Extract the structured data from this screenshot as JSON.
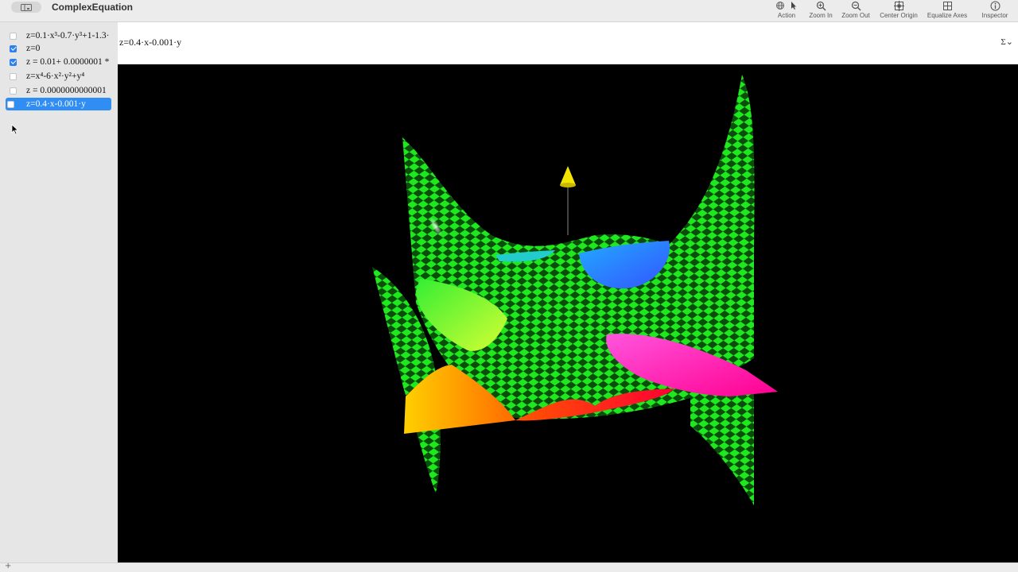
{
  "window": {
    "title": "ComplexEquation"
  },
  "toolbar": {
    "items": [
      {
        "label": "Action",
        "icon": "action-icon"
      },
      {
        "label": "Zoom In",
        "icon": "zoom-in-icon"
      },
      {
        "label": "Zoom Out",
        "icon": "zoom-out-icon"
      },
      {
        "label": "Center Origin",
        "icon": "center-origin-icon"
      },
      {
        "label": "Equalize Axes",
        "icon": "equalize-axes-icon"
      },
      {
        "label": "Inspector",
        "icon": "inspector-icon"
      }
    ]
  },
  "sidebar": {
    "equations": [
      {
        "text": "z=0.1·x³-0.7·y³+1-1.3·",
        "checked": false,
        "selected": false
      },
      {
        "text": "z=0",
        "checked": true,
        "selected": false
      },
      {
        "text": "z = 0.01+ 0.0000001 *",
        "checked": true,
        "selected": false
      },
      {
        "text": "z=x⁴-6·x²·y²+y⁴",
        "checked": false,
        "selected": false
      },
      {
        "text": "z = 0.0000000000001",
        "checked": false,
        "selected": false
      },
      {
        "text": "z=0.4·x-0.001·y",
        "checked": false,
        "selected": true
      }
    ]
  },
  "editor": {
    "equation": "z=0.4·x-0.001·y",
    "sigma_menu": "Σ⌄"
  },
  "colors": {
    "surface_green": "#00ff00",
    "surface_dark": "#0a4a0a",
    "selection_blue": "#2f8df4",
    "viewport_bg": "#000000"
  }
}
